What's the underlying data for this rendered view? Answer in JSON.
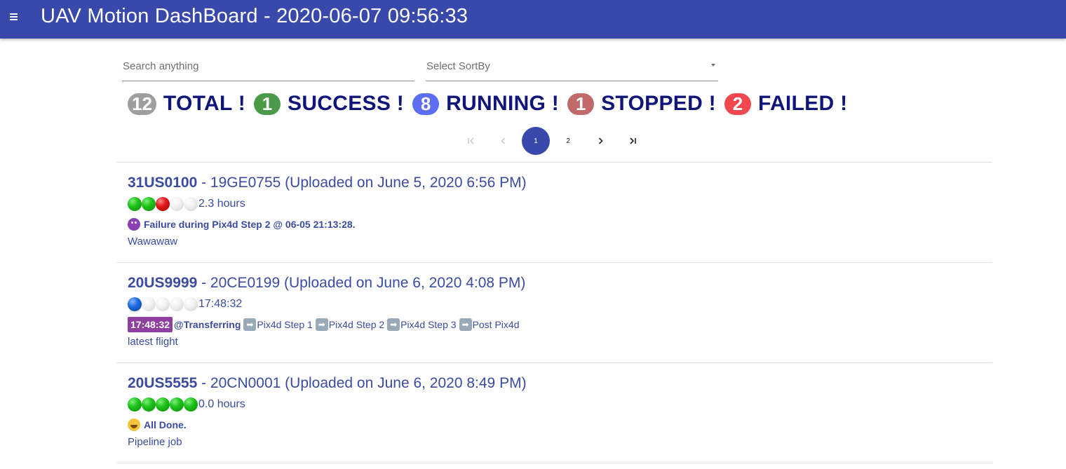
{
  "header": {
    "title": "UAV Motion DashBoard - 2020-06-07 09:56:33"
  },
  "filters": {
    "search_placeholder": "Search anything",
    "sort_placeholder": "Select SortBy"
  },
  "summary": [
    {
      "count": "12",
      "label": "TOTAL !",
      "color": "#9e9e9e"
    },
    {
      "count": "1",
      "label": "SUCCESS !",
      "color": "#4a9a4a"
    },
    {
      "count": "8",
      "label": "RUNNING !",
      "color": "#5c6ef2"
    },
    {
      "count": "1",
      "label": "STOPPED !",
      "color": "#c06a6a"
    },
    {
      "count": "2",
      "label": "FAILED !",
      "color": "#f2474f"
    }
  ],
  "pagination": {
    "pages": [
      "1",
      "2"
    ],
    "current": "1"
  },
  "items": [
    {
      "id": "31US0100",
      "sep": " - ",
      "sub": "19GE0755 (Uploaded on June 5, 2020 6:56 PM)",
      "dots": [
        "green",
        "green",
        "red",
        "empty",
        "empty"
      ],
      "duration": "2.3 hours",
      "status_icon": "devil-emoji-icon",
      "status_text": "Failure during Pix4d Step 2 @ 06-05 21:13:28.",
      "description": "Wawawaw"
    },
    {
      "id": "20US9999",
      "sep": " - ",
      "sub": "20CE0199 (Uploaded on June 6, 2020 4:08 PM)",
      "dots": [
        "blue",
        "empty",
        "empty",
        "empty",
        "empty"
      ],
      "duration": "17:48:32",
      "time_chip": "17:48:32",
      "current_step": "@Transferring",
      "steps": [
        "Pix4d Step 1",
        "Pix4d Step 2",
        "Pix4d Step 3",
        "Post Pix4d"
      ],
      "description": "latest flight"
    },
    {
      "id": "20US5555",
      "sep": " - ",
      "sub": "20CN0001 (Uploaded on June 6, 2020 8:49 PM)",
      "dots": [
        "green",
        "green",
        "green",
        "green",
        "green"
      ],
      "duration": "0.0 hours",
      "status_icon": "grin-emoji-icon",
      "status_text": "All Done.",
      "description": "Pipeline job"
    }
  ]
}
